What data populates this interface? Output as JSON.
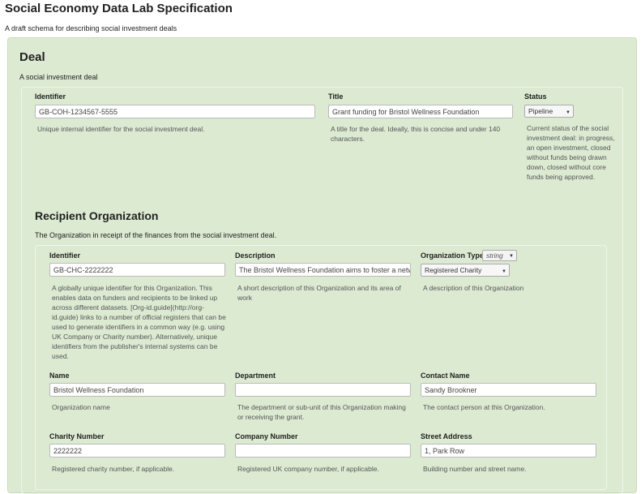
{
  "page": {
    "title": "Social Economy Data Lab Specification",
    "subtitle": "A draft schema for describing social investment deals"
  },
  "deal": {
    "title": "Deal",
    "description": "A social investment deal",
    "identifier": {
      "label": "Identifier",
      "value": "GB-COH-1234567-5555",
      "help": "Unique internal identifier for the social investment deal."
    },
    "title_field": {
      "label": "Title",
      "value": "Grant funding for Bristol Wellness Foundation",
      "help": "A title for the deal. Ideally, this is concise and under 140 characters."
    },
    "status": {
      "label": "Status",
      "value": "Pipeline",
      "help": "Current status of the social investment deal: in progress, an open investment, closed without funds being drawn down, closed without core funds being approved."
    }
  },
  "recipient": {
    "title": "Recipient Organization",
    "description": "The Organization in receipt of the finances from the social investment deal.",
    "identifier": {
      "label": "Identifier",
      "value": "GB-CHC-2222222",
      "help": "A globally unique identifier for this Organization. This enables data on funders and recipients to be linked up across different datasets. [Org-id.guide](http://org-id.guide) links to a number of official registers that can be used to generate identifiers in a common way (e.g. using UK Company or Charity number). Alternatively, unique identifiers from the publisher's internal systems can be used."
    },
    "description_field": {
      "label": "Description",
      "value": "The Bristol Wellness Foundation aims to foster a netwo",
      "help": "A short description of this Organization and its area of work"
    },
    "org_type": {
      "label": "Organization Type",
      "type_chip": "string",
      "value": "Registered Charity",
      "help": "A description of this Organization"
    },
    "name": {
      "label": "Name",
      "value": "Bristol Wellness Foundation",
      "help": "Organization name"
    },
    "department": {
      "label": "Department",
      "value": "",
      "help": "The department or sub-unit of this Organization making or receiving the grant."
    },
    "contact_name": {
      "label": "Contact Name",
      "value": "Sandy Brookner",
      "help": "The contact person at this Organization."
    },
    "charity_number": {
      "label": "Charity Number",
      "value": "2222222",
      "help": "Registered charity number, if applicable."
    },
    "company_number": {
      "label": "Company Number",
      "value": "",
      "help": "Registered UK company number, if applicable."
    },
    "street_address": {
      "label": "Street Address",
      "value": "1, Park Row",
      "help": "Building number and street name."
    }
  },
  "icons": {
    "dropdown": "caret-down-icon"
  }
}
